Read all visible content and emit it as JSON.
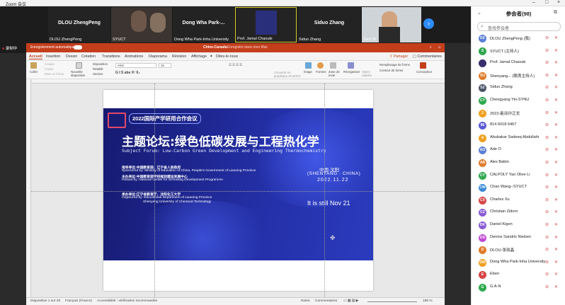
{
  "zoom": {
    "title": "Zoom 会议"
  },
  "tiles": [
    {
      "name": "DLOU ZhengPeng",
      "label": "DLOU ZhengPeng",
      "type": "name"
    },
    {
      "name": "",
      "label": "SYUCT",
      "type": "video"
    },
    {
      "name": "Dong Wha Park-...",
      "label": "Dong Wha Park-Inha University",
      "type": "name"
    },
    {
      "name": "",
      "label": "Prof. Jamal Chaouki",
      "type": "video"
    },
    {
      "name": "Siduo Zhang",
      "label": "Siduo Zhang",
      "type": "name"
    },
    {
      "name": "",
      "label": "Tony Bi",
      "type": "video"
    }
  ],
  "recording": {
    "label": "录制中"
  },
  "ppt": {
    "autosave": "Enregistrement automatique",
    "doc_title": "Chine-Canada",
    "save_state": "Enregistré dans mon Mac",
    "search": "Dites-le-nous",
    "tabs": [
      "Accueil",
      "Insertion",
      "Dessin",
      "Création",
      "Transitions",
      "Animations",
      "Diaporama",
      "Révision",
      "Affichage"
    ],
    "share": "Partager",
    "comments": "Commentaires",
    "ribbon": {
      "paste": "Coller",
      "cut": "Couper",
      "copy": "Copier",
      "format": "Mise en forme",
      "new_slide": "Nouvelle diapositive",
      "layout": "Disposition",
      "reset": "Rétablir",
      "section": "Section",
      "font": "Arial",
      "size": "16",
      "convert": "Convertir en graphique SmartArt",
      "image": "Image",
      "shapes": "Formes",
      "textbox": "Zone de texte",
      "arrange": "Réorganiser",
      "styles": "Styles rapides",
      "fill": "Remplissage de forme",
      "outline": "Contour de forme",
      "designer": "Concepteur"
    },
    "status": {
      "slide": "Diapositive 1 sur 26",
      "lang": "Français (France)",
      "access": "Accessibilité : vérification recommandée",
      "notes": "Notes",
      "comments": "Commentaires",
      "zoom": "186 %"
    }
  },
  "slide": {
    "badge": "2022国际产学研用合作会议",
    "title_cn": "主题论坛:绿色低碳发展与工程热化学",
    "title_en": "Subject Forum: Low-Carbon Green Development and Engineering Thermochemistry",
    "sponsor_cn": "指导单位:中国教育部、辽宁省人民政府",
    "sponsor_en": "Sponsored by: Ministry of Education of China, People's Government of Liaoning Province",
    "host_cn": "主办单位:中国教育部学校规划建设发展中心",
    "host_en": "Hosted by: National Center for Schooling Development Programme",
    "org_cn": "承办单位:辽宁省教育厅、沈阳化工大学",
    "org_en": "Organized by: Educational Department of Liaoning Province",
    "org_en2": "Shenyang University of Chemical Technology",
    "city_cn": "中国·沈阳",
    "city_en": "(SHENYANG · CHINA)",
    "date": "2022.11.22",
    "note": "It is still Nov 21"
  },
  "participants": {
    "title": "参会者(98)",
    "search_placeholder": "查找参会者",
    "list": [
      {
        "initials": "DZ",
        "name": "DLOU ZhengPeng (我)",
        "color": "#5b7fd6"
      },
      {
        "initials": "S",
        "name": "SYUCT (主持人)",
        "color": "#2fa84f"
      },
      {
        "initials": "",
        "name": "Prof. Jamal Chaouki",
        "color": "#3a2d6e"
      },
      {
        "initials": "SU",
        "name": "Shenyang... (联席主持人)",
        "color": "#e07b2a"
      },
      {
        "initials": "SZ",
        "name": "Siduo Zhang",
        "color": "#4a5566"
      },
      {
        "initials": "CY",
        "name": "Chengyang Yin-SYNU",
        "color": "#2fa84f"
      },
      {
        "initials": "2",
        "name": "2022-能动孙正龙",
        "color": "#f0a020"
      },
      {
        "initials": "86",
        "name": "814 6018 6467",
        "color": "#5b5bd6"
      },
      {
        "initials": "A",
        "name": "Abubakar Sadeeq Abdullahi",
        "color": "#f0a020"
      },
      {
        "initials": "AO",
        "name": "Ade O",
        "color": "#5b7fd6"
      },
      {
        "initials": "AB",
        "name": "Alex Babin",
        "color": "#e07b2a"
      },
      {
        "initials": "CY",
        "name": "CALPOLY Yao Olive Li",
        "color": "#2fa84f"
      },
      {
        "initials": "CW",
        "name": "Chao Wang--SYUCT",
        "color": "#3a8ad6"
      },
      {
        "initials": "CX",
        "name": "Charles Xu",
        "color": "#d64545"
      },
      {
        "initials": "CZ",
        "name": "Christian Zidorn",
        "color": "#8a5bd6"
      },
      {
        "initials": "DK",
        "name": "Daniel Kigen",
        "color": "#8a5bd6"
      },
      {
        "initials": "DS",
        "name": "Dennis Sandris Nielsen",
        "color": "#c24bd6"
      },
      {
        "initials": "D",
        "name": "DLOU-张琰晶",
        "color": "#e07b2a"
      },
      {
        "initials": "DW",
        "name": "Dong Wha Park-Inha University",
        "color": "#f0a020"
      },
      {
        "initials": "E",
        "name": "Eben",
        "color": "#d64545"
      },
      {
        "initials": "G",
        "name": "G.A-N",
        "color": "#2fa84f"
      }
    ]
  }
}
